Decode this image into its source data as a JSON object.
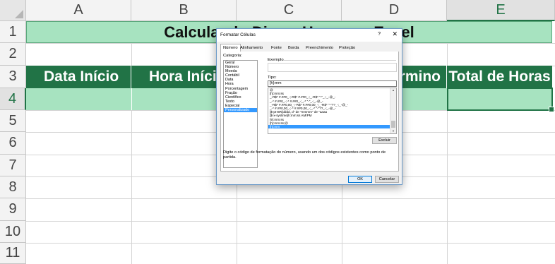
{
  "sheet": {
    "columns": [
      "A",
      "B",
      "C",
      "D",
      "E"
    ],
    "rows": [
      "1",
      "2",
      "3",
      "4",
      "5",
      "6",
      "7",
      "8",
      "9",
      "10",
      "11"
    ],
    "title": "Calculando Dias e Horas no Excel",
    "headers": [
      "Data Início",
      "Hora Início",
      "",
      "rmino",
      "Total de Horas"
    ],
    "accent_color": "#217346",
    "band_color": "#a7e3c0"
  },
  "dialog": {
    "title": "Formatar Células",
    "help": "?",
    "close": "✕",
    "tabs": [
      "Número",
      "Alinhamento",
      "Fonte",
      "Borda",
      "Preenchimento",
      "Proteção"
    ],
    "category_label": "Categoria:",
    "categories": [
      "Geral",
      "Número",
      "Moeda",
      "Contábil",
      "Data",
      "Hora",
      "Porcentagem",
      "Fração",
      "Científico",
      "Texto",
      "Especial",
      "Personalizado"
    ],
    "selected_category": "Personalizado",
    "example_label": "Exemplo",
    "type_label": "Tipo:",
    "type_value": "[h]:mm",
    "formats": [
      "@",
      "[h]:mm:ss",
      "_-R$* #.##0_-;-R$* #.##0_-;_-R$* \"-\"_-;_-@_-",
      "_-* #.##0_-;-* #.##0_-;_-* \"-\"_-;_-@_-",
      "_-R$* #.##0,00_-;-R$* #.##0,00_-;_-R$* \"-\"??_-;_-@_-",
      "_-* #.##0,00_-;-* #.##0,00_-;_-* \"-\"??_-;_-@_-",
      "[$-pt-BR]dddd, d\" de \"mmmm\" de \"aaaa",
      "[$-x-systime]h:mm:ss AM/PM",
      "hh:mm:ss",
      "[h]:mm:ss;@",
      "[h]:mm"
    ],
    "selected_format": "[h]:mm",
    "delete_button": "Excluir",
    "help_text": "Digite o código de formatação do número, usando um dos códigos existentes como ponto de partida.",
    "ok_button": "OK",
    "cancel_button": "Cancelar"
  }
}
